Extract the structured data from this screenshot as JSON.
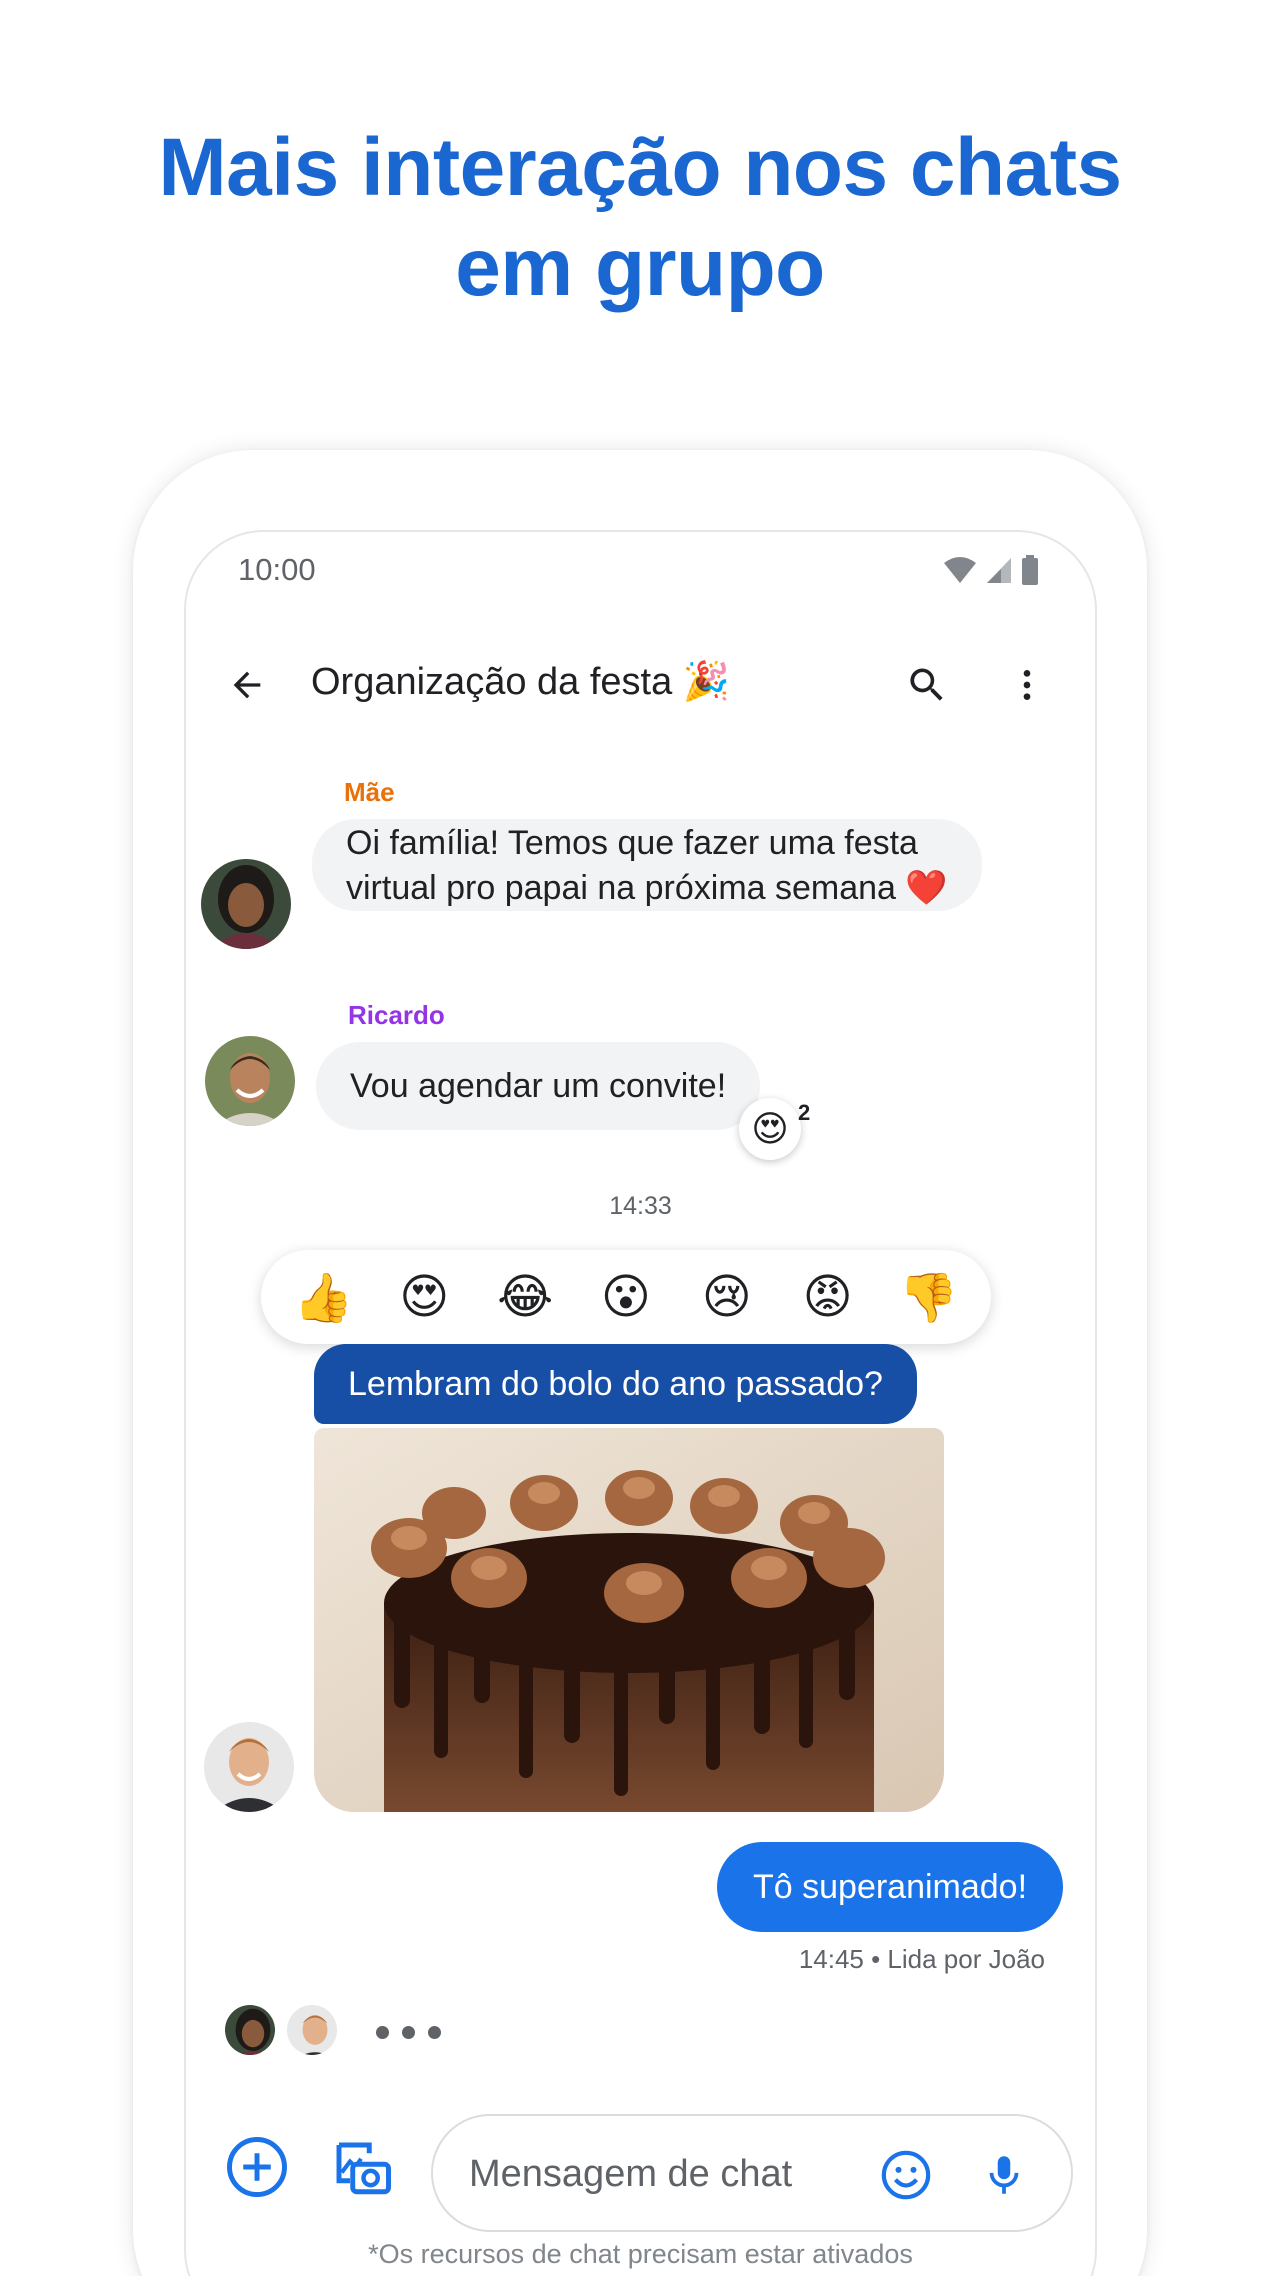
{
  "headline": {
    "line1": "Mais interação nos chats",
    "line2": "em grupo"
  },
  "status_bar": {
    "time": "10:00"
  },
  "app_bar": {
    "title": "Organização da festa 🎉"
  },
  "messages": {
    "mae": {
      "sender": "Mãe",
      "line1": "Oi família! Temos que fazer uma festa",
      "line2": "virtual pro papai na próxima semana ❤️"
    },
    "ricardo": {
      "sender": "Ricardo",
      "text": "Vou agendar um convite!",
      "reaction": "😍",
      "reaction_count": "2"
    },
    "timestamp": "14:33",
    "reaction_options": [
      "👍",
      "😍",
      "😂",
      "😮",
      "😢",
      "😡",
      "👎"
    ],
    "joao": {
      "text": "Lembram do bolo do ano passado?"
    },
    "outgoing": {
      "text": "Tô superanimado!",
      "receipt": "14:45 • Lida por João"
    }
  },
  "compose": {
    "placeholder": "Mensagem de chat"
  },
  "footnote": "*Os recursos de chat precisam estar ativados",
  "colors": {
    "headline": "#1a67d2",
    "mae_name": "#e8710a",
    "ricardo_name": "#9334e6",
    "blue_bubble": "#174ea6",
    "outgoing_bubble": "#1a73e8",
    "icon_blue": "#1a73e8"
  }
}
